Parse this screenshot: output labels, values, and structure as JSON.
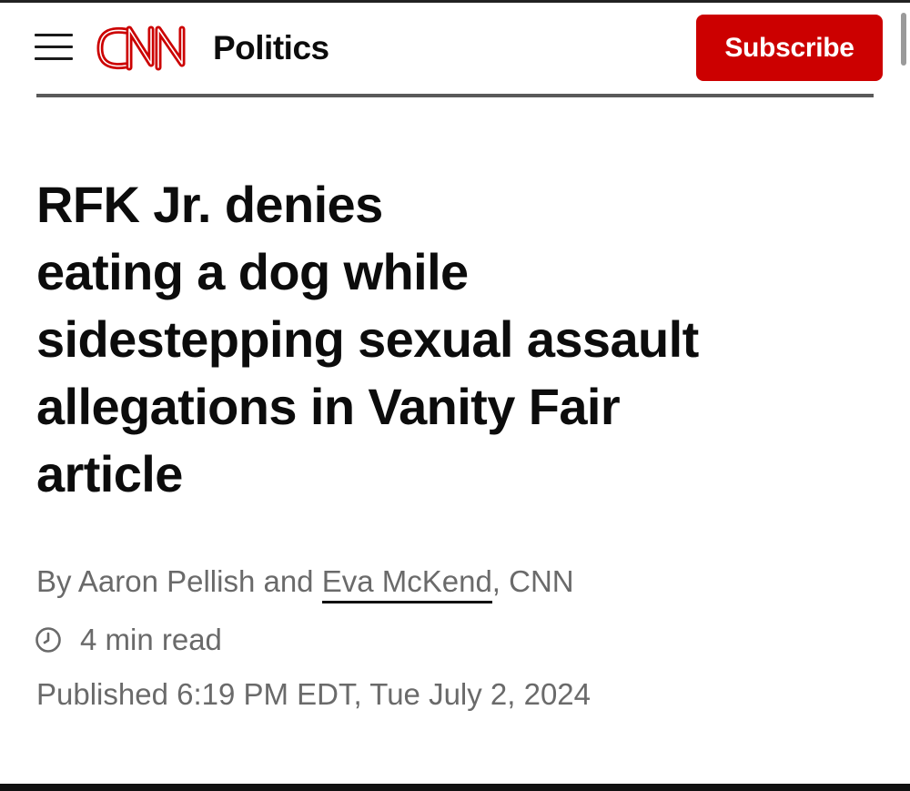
{
  "header": {
    "brand": "CNN",
    "section": "Politics",
    "subscribe_label": "Subscribe"
  },
  "article": {
    "headline_lines": [
      "RFK Jr. denies",
      "eating a dog while",
      "sidestepping sexual assault",
      "allegations in Vanity Fair",
      "article"
    ],
    "byline": {
      "prefix": "By Aaron Pellish and ",
      "linked_author": "Eva McKend",
      "suffix": ", CNN"
    },
    "read_time": "4 min read",
    "published": "Published 6:19 PM EDT, Tue July 2, 2024"
  },
  "icons": {
    "menu": "menu-icon",
    "clock": "clock-icon"
  },
  "colors": {
    "brand_red": "#cc0000",
    "text_primary": "#0c0c0c",
    "text_secondary": "#6a6a6a"
  }
}
